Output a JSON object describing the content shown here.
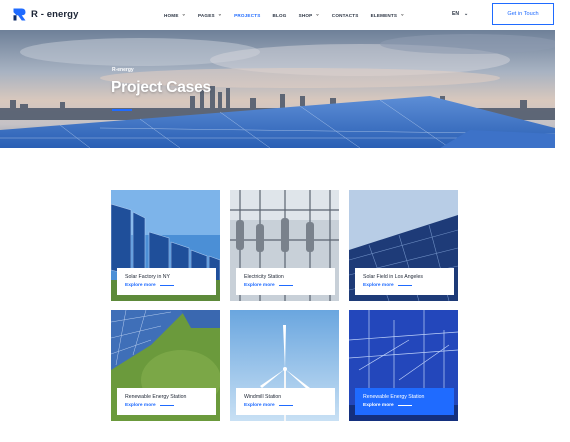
{
  "brand": {
    "name": "R - energy"
  },
  "nav": [
    {
      "label": "HOME",
      "has_dropdown": true,
      "active": false
    },
    {
      "label": "PAGES",
      "has_dropdown": true,
      "active": false
    },
    {
      "label": "PROJECTS",
      "has_dropdown": false,
      "active": true
    },
    {
      "label": "BLOG",
      "has_dropdown": false,
      "active": false
    },
    {
      "label": "SHOP",
      "has_dropdown": true,
      "active": false
    },
    {
      "label": "CONTACTS",
      "has_dropdown": false,
      "active": false
    },
    {
      "label": "ELEMENTS",
      "has_dropdown": true,
      "active": false
    }
  ],
  "language": {
    "value": "EN"
  },
  "cta": {
    "label": "Get in Touch"
  },
  "hero": {
    "kicker": "R-energy",
    "title": "Project Cases"
  },
  "cases": [
    {
      "title": "Solar Factory in NY",
      "link": "Explore more",
      "highlight": false
    },
    {
      "title": "Electricity Station",
      "link": "Explore more",
      "highlight": false
    },
    {
      "title": "Solar Field in Los Angeles",
      "link": "Explore more",
      "highlight": false
    },
    {
      "title": "Renewable Energy Station",
      "link": "Explore more",
      "highlight": false
    },
    {
      "title": "Windmill Station",
      "link": "Explore more",
      "highlight": false
    },
    {
      "title": "Renewable Energy Station",
      "link": "Explore more",
      "highlight": true
    }
  ],
  "colors": {
    "accent": "#1f6bff",
    "text_dark": "#1d2533"
  }
}
